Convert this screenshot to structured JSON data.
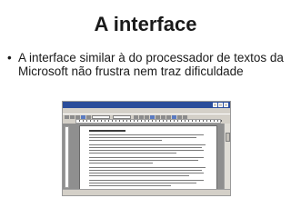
{
  "slide": {
    "title": "A interface",
    "bullets": [
      {
        "marker": "•",
        "text": "A interface similar à do processador de textos da Microsoft não frustra nem traz dificuldade"
      }
    ]
  },
  "screenshot": {
    "window_title_bar_color": "#2a4d9b",
    "workspace_color": "#8f8f8f",
    "title": "",
    "menu": [],
    "status": ""
  }
}
